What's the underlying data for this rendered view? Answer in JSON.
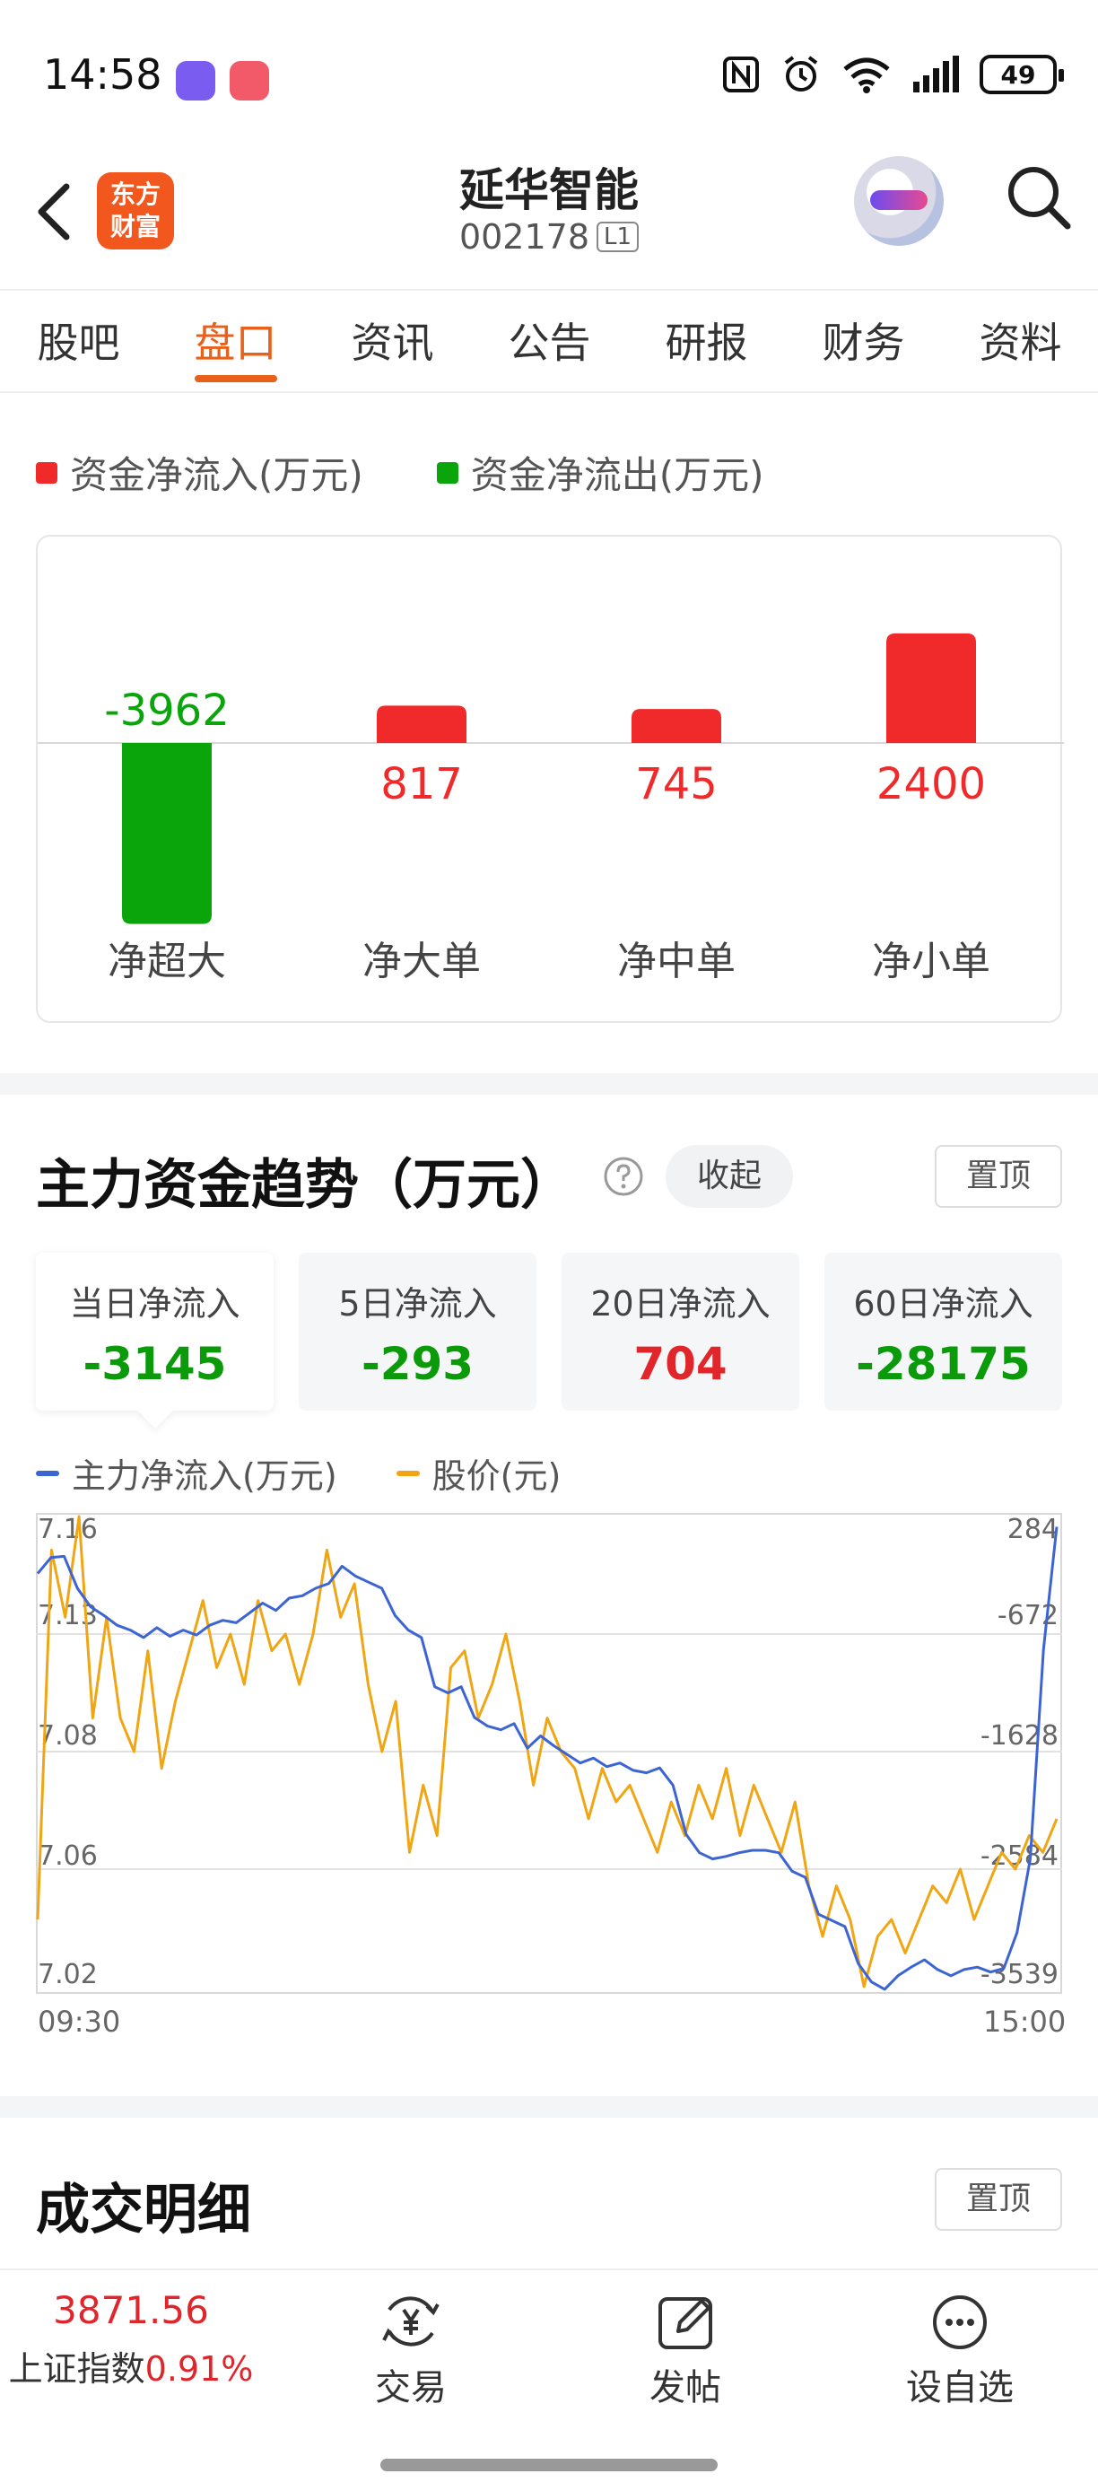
{
  "status_bar": {
    "time": "14:58",
    "battery": "49"
  },
  "header": {
    "logo_line1": "东方",
    "logo_line2": "财富",
    "stock_name": "延华智能",
    "stock_code": "002178",
    "level": "L1"
  },
  "tabs": [
    "股吧",
    "盘口",
    "资讯",
    "公告",
    "研报",
    "财务",
    "资料"
  ],
  "active_tab": "盘口",
  "flow": {
    "legend_in": "资金净流入(万元)",
    "legend_out": "资金净流出(万元)",
    "colors": {
      "in": "#f02a2a",
      "out": "#0aa50a"
    }
  },
  "trend": {
    "title": "主力资金趋势（万元）",
    "collapse_label": "收起",
    "pin_label": "置顶",
    "periods": [
      {
        "label": "当日净流入",
        "value": "-3145",
        "color": "#0a9a0a"
      },
      {
        "label": "5日净流入",
        "value": "-293",
        "color": "#0a9a0a"
      },
      {
        "label": "20日净流入",
        "value": "704",
        "color": "#e1262b"
      },
      {
        "label": "60日净流入",
        "value": "-28175",
        "color": "#0a9a0a"
      }
    ],
    "legend_main": "主力净流入(万元)",
    "legend_price": "股价(元)",
    "time_start": "09:30",
    "time_end": "15:00"
  },
  "detail": {
    "title": "成交明细",
    "pin_label": "置顶"
  },
  "bottom_bar": {
    "index_value": "3871.56",
    "index_name": "上证指数",
    "index_change": "0.91%",
    "trade_label": "交易",
    "post_label": "发帖",
    "watch_label": "设自选"
  },
  "chart_data": [
    {
      "type": "bar",
      "categories": [
        "净超大",
        "净大单",
        "净中单",
        "净小单"
      ],
      "values": [
        -3962,
        817,
        745,
        2400
      ],
      "legend": [
        "资金净流入(万元)",
        "资金净流出(万元)"
      ],
      "colors": {
        "positive": "#f02a2a",
        "negative": "#0aa50a"
      }
    },
    {
      "type": "line",
      "x": [
        "09:30",
        "15:00"
      ],
      "y_left_label": "股价(元)",
      "y_left_ticks": [
        "7.16",
        "7.13",
        "7.08",
        "7.06",
        "7.02"
      ],
      "y_left_range": [
        7.02,
        7.16
      ],
      "y_right_label": "主力净流入(万元)",
      "y_right_ticks": [
        "284",
        "-672",
        "-1628",
        "-2584",
        "-3539"
      ],
      "y_right_range": [
        -3539,
        284
      ],
      "series": [
        {
          "name": "主力净流入(万元)",
          "color": "#3c64d2",
          "values": [
            -180,
            -50,
            -40,
            -300,
            -450,
            -520,
            -600,
            -640,
            -700,
            -620,
            -690,
            -640,
            -680,
            -600,
            -560,
            -580,
            -500,
            -420,
            -480,
            -380,
            -360,
            -300,
            -260,
            -120,
            -200,
            -250,
            -300,
            -520,
            -640,
            -700,
            -1100,
            -1150,
            -1100,
            -1350,
            -1420,
            -1450,
            -1400,
            -1600,
            -1500,
            -1580,
            -1650,
            -1720,
            -1680,
            -1750,
            -1720,
            -1780,
            -1800,
            -1760,
            -1900,
            -2300,
            -2450,
            -2500,
            -2480,
            -2450,
            -2430,
            -2430,
            -2450,
            -2600,
            -2650,
            -2950,
            -3000,
            -3050,
            -3350,
            -3500,
            -3560,
            -3450,
            -3380,
            -3320,
            -3400,
            -3450,
            -3400,
            -3380,
            -3420,
            -3390,
            -3100,
            -2500,
            -800,
            200
          ]
        },
        {
          "name": "股价(元)",
          "color": "#f0a614",
          "values": [
            7.04,
            7.15,
            7.13,
            7.16,
            7.1,
            7.13,
            7.1,
            7.09,
            7.12,
            7.085,
            7.105,
            7.12,
            7.135,
            7.115,
            7.125,
            7.11,
            7.135,
            7.12,
            7.125,
            7.11,
            7.125,
            7.15,
            7.13,
            7.14,
            7.11,
            7.09,
            7.105,
            7.06,
            7.08,
            7.065,
            7.115,
            7.12,
            7.1,
            7.11,
            7.125,
            7.105,
            7.08,
            7.1,
            7.09,
            7.085,
            7.07,
            7.085,
            7.075,
            7.08,
            7.07,
            7.06,
            7.075,
            7.065,
            7.08,
            7.07,
            7.085,
            7.065,
            7.08,
            7.07,
            7.06,
            7.075,
            7.05,
            7.035,
            7.05,
            7.04,
            7.02,
            7.035,
            7.04,
            7.03,
            7.04,
            7.05,
            7.045,
            7.055,
            7.04,
            7.05,
            7.06,
            7.055,
            7.065,
            7.06,
            7.07
          ]
        }
      ]
    }
  ]
}
